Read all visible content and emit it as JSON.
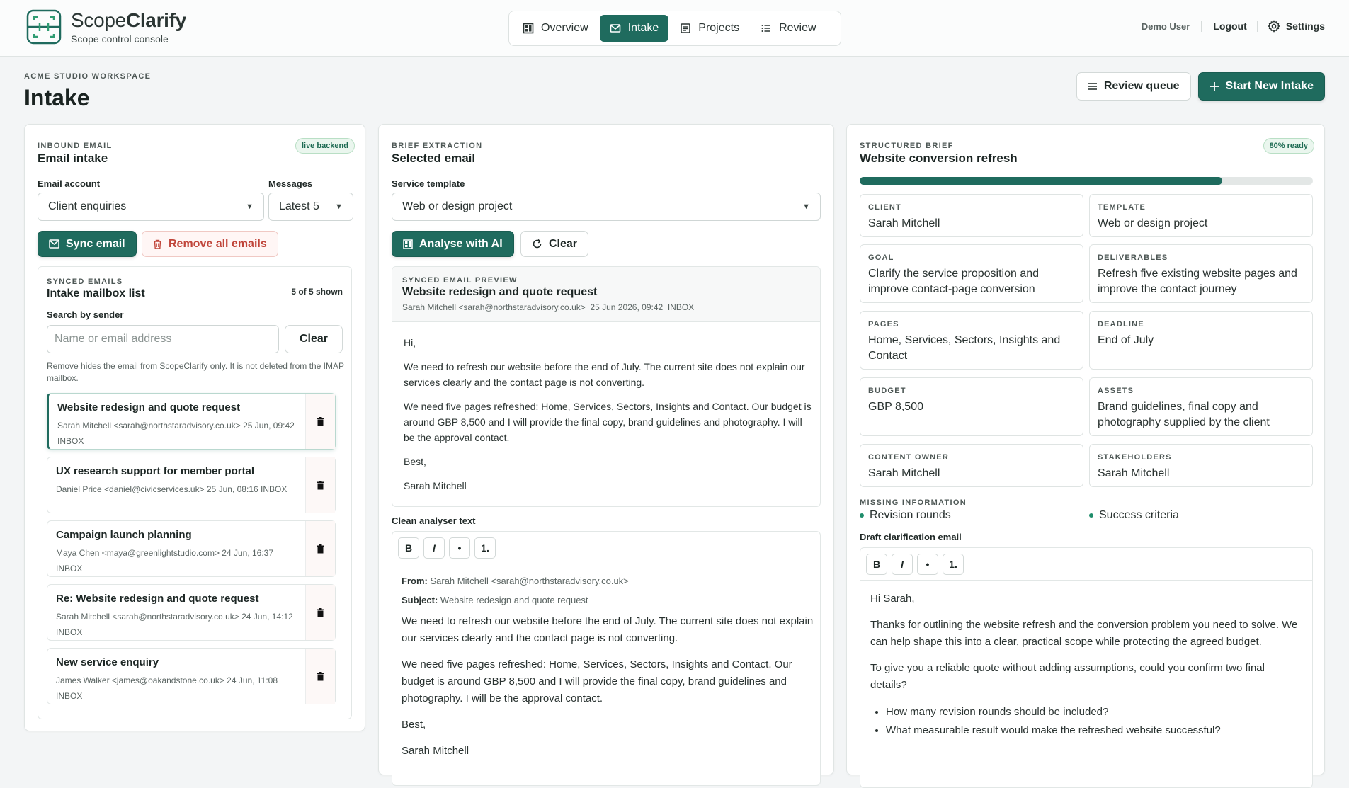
{
  "app": {
    "name_light": "Scope",
    "name_bold": "Clarify",
    "subtitle": "Scope control console"
  },
  "nav": {
    "tabs": [
      {
        "label": "Overview"
      },
      {
        "label": "Intake"
      },
      {
        "label": "Projects"
      },
      {
        "label": "Review"
      }
    ],
    "active": "Intake"
  },
  "user": {
    "name": "Demo User",
    "logout": "Logout",
    "settings": "Settings"
  },
  "page": {
    "workspace": "ACME STUDIO WORKSPACE",
    "title": "Intake",
    "review_queue": "Review queue",
    "start_new": "Start New Intake"
  },
  "inbound": {
    "eyebrow": "INBOUND EMAIL",
    "title": "Email intake",
    "badge": "live backend",
    "account_label": "Email account",
    "account_value": "Client enquiries",
    "messages_label": "Messages",
    "messages_value": "Latest 5",
    "sync": "Sync email",
    "remove_all": "Remove all emails",
    "list_eyebrow": "SYNCED EMAILS",
    "list_title": "Intake mailbox list",
    "shown": "5 of 5 shown",
    "search_label": "Search by sender",
    "search_placeholder": "Name or email address",
    "clear": "Clear",
    "note": "Remove hides the email from ScopeClarify only. It is not deleted from the IMAP mailbox.",
    "emails": [
      {
        "subject": "Website redesign and quote request",
        "meta": "Sarah Mitchell <sarah@northstaradvisory.co.uk> 25 Jun, 09:42 INBOX"
      },
      {
        "subject": "UX research support for member portal",
        "meta": "Daniel Price <daniel@civicservices.uk> 25 Jun, 08:16 INBOX"
      },
      {
        "subject": "Campaign launch planning",
        "meta": "Maya Chen <maya@greenlightstudio.com> 24 Jun, 16:37 INBOX"
      },
      {
        "subject": "Re: Website redesign and quote request",
        "meta": "Sarah Mitchell <sarah@northstaradvisory.co.uk> 24 Jun, 14:12 INBOX"
      },
      {
        "subject": "New service enquiry",
        "meta": "James Walker <james@oakandstone.co.uk> 24 Jun, 11:08 INBOX"
      }
    ]
  },
  "brief": {
    "eyebrow": "BRIEF EXTRACTION",
    "title": "Selected email",
    "template_label": "Service template",
    "template_value": "Web or design project",
    "analyse": "Analyse with AI",
    "clear": "Clear",
    "preview_eyebrow": "SYNCED EMAIL PREVIEW",
    "preview_subject": "Website redesign and quote request",
    "preview_meta": "Sarah Mitchell <sarah@northstaradvisory.co.uk>  25 Jun 2026, 09:42  INBOX",
    "preview_body": [
      "Hi,",
      "We need to refresh our website before the end of July. The current site does not explain our services clearly and the contact page is not converting.",
      "We need five pages refreshed: Home, Services, Sectors, Insights and Contact. Our budget is around GBP 8,500 and I will provide the final copy, brand guidelines and photography. I will be the approval contact.",
      "Best,",
      "Sarah Mitchell"
    ],
    "analyser_label": "Clean analyser text",
    "from_label": "From:",
    "from_value": "Sarah Mitchell <sarah@northstaradvisory.co.uk>",
    "subject_label": "Subject:",
    "subject_value": "Website redesign and quote request",
    "analyser_body": [
      "We need to refresh our website before the end of July. The current site does not explain our services clearly and the contact page is not converting.",
      "We need five pages refreshed: Home, Services, Sectors, Insights and Contact. Our budget is around GBP 8,500 and I will provide the final copy, brand guidelines and photography. I will be the approval contact.",
      "Best,",
      "Sarah Mitchell"
    ]
  },
  "structured": {
    "eyebrow": "STRUCTURED BRIEF",
    "title": "Website conversion refresh",
    "badge": "80% ready",
    "progress": 0.8,
    "fields": [
      {
        "label": "CLIENT",
        "value": "Sarah Mitchell"
      },
      {
        "label": "TEMPLATE",
        "value": "Web or design project"
      },
      {
        "label": "GOAL",
        "value": "Clarify the service proposition and improve contact-page conversion"
      },
      {
        "label": "DELIVERABLES",
        "value": "Refresh five existing website pages and improve the contact journey"
      },
      {
        "label": "PAGES",
        "value": "Home, Services, Sectors, Insights and Contact"
      },
      {
        "label": "DEADLINE",
        "value": "End of July"
      },
      {
        "label": "BUDGET",
        "value": "GBP 8,500"
      },
      {
        "label": "ASSETS",
        "value": "Brand guidelines, final copy and photography supplied by the client"
      },
      {
        "label": "CONTENT OWNER",
        "value": "Sarah Mitchell"
      },
      {
        "label": "STAKEHOLDERS",
        "value": "Sarah Mitchell"
      }
    ],
    "missing_label": "MISSING INFORMATION",
    "missing": [
      "Revision rounds",
      "Success criteria"
    ],
    "draft_label": "Draft clarification email",
    "draft_body": [
      "Hi Sarah,",
      "Thanks for outlining the website refresh and the conversion problem you need to solve. We can help shape this into a clear, practical scope while protecting the agreed budget.",
      "To give you a reliable quote without adding assumptions, could you confirm two final details?"
    ],
    "draft_bullets": [
      "How many revision rounds should be included?",
      "What measurable result would make the refreshed website successful?"
    ]
  },
  "toolbar": {
    "bold": "B",
    "italic": "I",
    "bullet": "•",
    "numbered": "1."
  },
  "colors": {
    "accent": "#1f6b5e",
    "danger": "#c0453a",
    "ready": "#1c6a52"
  }
}
